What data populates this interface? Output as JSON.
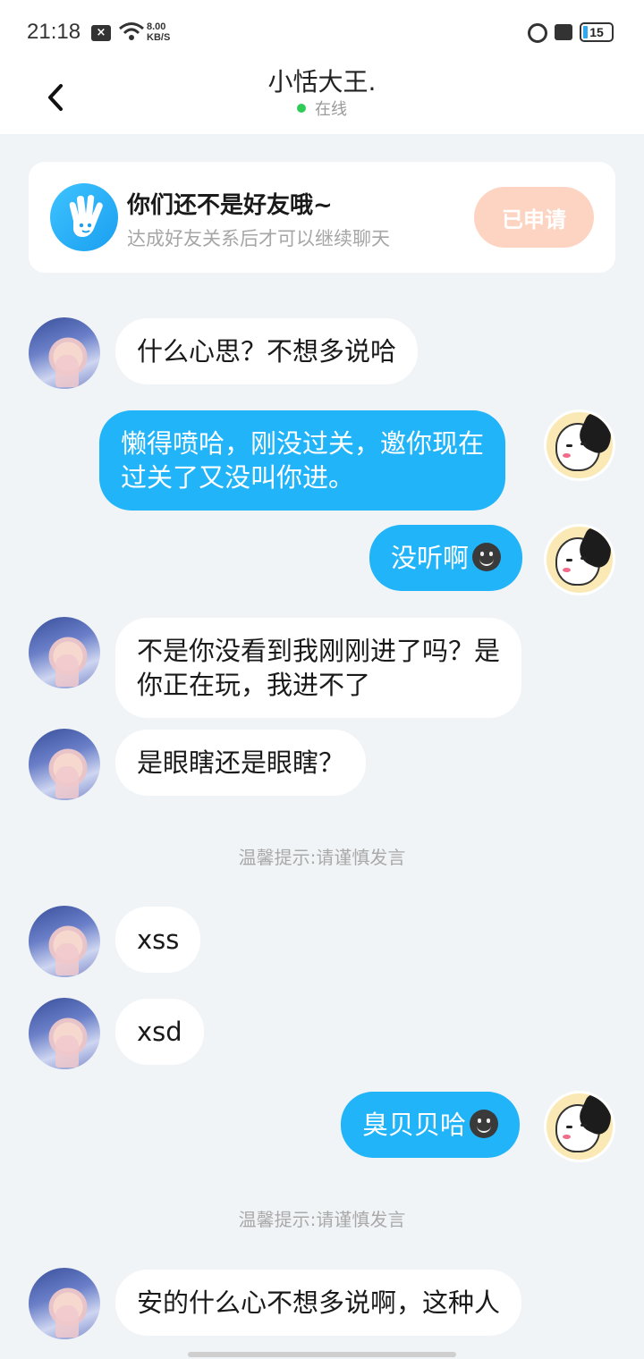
{
  "status_bar": {
    "time": "21:18",
    "speed_value": "8.00",
    "speed_unit": "KB/S",
    "battery": "15"
  },
  "header": {
    "title": "小恬大王.",
    "status": "在线"
  },
  "friend_card": {
    "title": "你们还不是好友哦~",
    "subtitle": "达成好友关系后才可以继续聊天",
    "button_label": "已申请"
  },
  "messages": [
    {
      "from": "other",
      "text": "什么心思？不想多说哈"
    },
    {
      "from": "self",
      "lines": [
        "懒得喷哈，刚没过关，邀你现在",
        "过关了又没叫你进。"
      ]
    },
    {
      "from": "self",
      "text": "没听啊",
      "emoji": "dark-smile-emoji"
    },
    {
      "from": "other",
      "lines": [
        "不是你没看到我刚刚进了吗？是",
        "你正在玩，我进不了"
      ]
    },
    {
      "from": "other",
      "text": "是眼瞎还是眼瞎？"
    },
    {
      "from": "system",
      "text": "温馨提示:请谨慎发言"
    },
    {
      "from": "other",
      "text": "xss"
    },
    {
      "from": "other",
      "text": "xsd"
    },
    {
      "from": "self",
      "text": "臭贝贝哈",
      "emoji": "dark-smile-emoji"
    },
    {
      "from": "system",
      "text": "温馨提示:请谨慎发言"
    },
    {
      "from": "other",
      "text": "安的什么心不想多说啊，这种人"
    }
  ],
  "colors": {
    "self_bubble": "#22b4f8",
    "background": "#f1f4f7",
    "applied_button": "#fdd4c2",
    "online_dot": "#2ecb57"
  }
}
